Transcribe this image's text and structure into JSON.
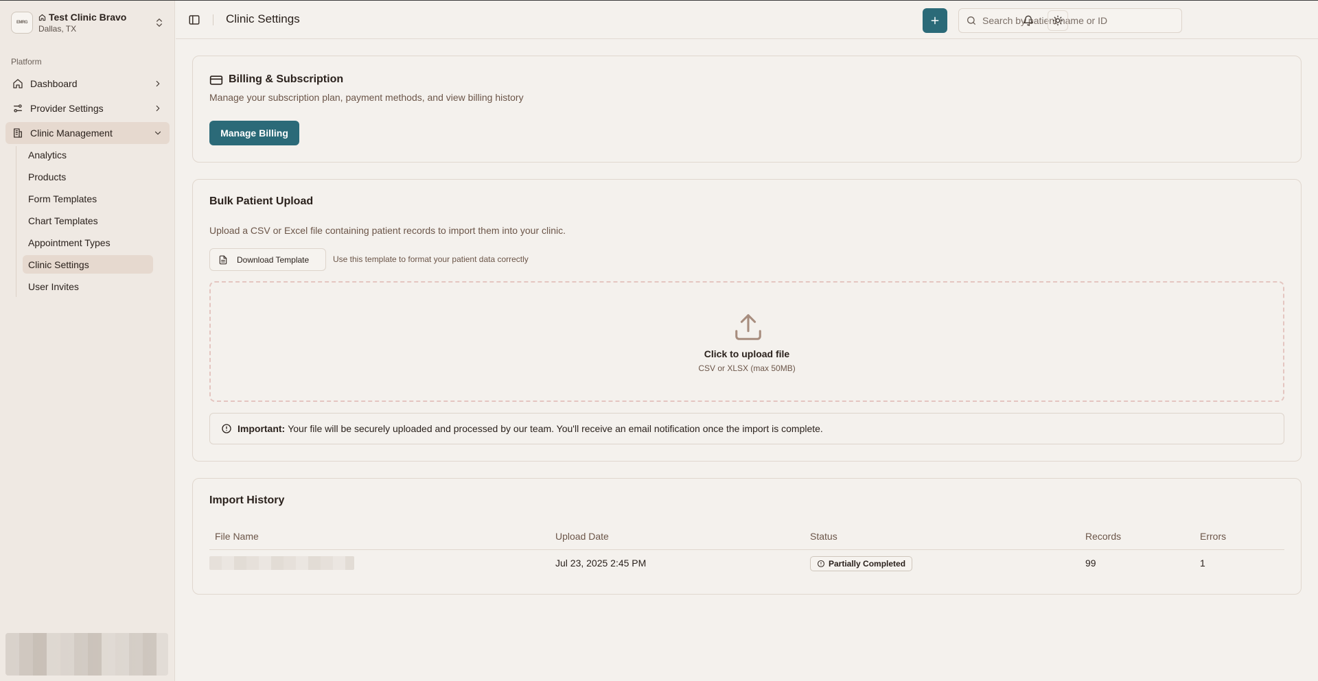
{
  "clinic": {
    "logo_text": "EMRG",
    "name": "Test Clinic Bravo",
    "city": "Dallas, TX"
  },
  "sidebar": {
    "section_label": "Platform",
    "items": [
      {
        "label": "Dashboard",
        "icon": "home-icon"
      },
      {
        "label": "Provider Settings",
        "icon": "sliders-icon"
      },
      {
        "label": "Clinic Management",
        "icon": "building-icon"
      }
    ],
    "subitems": [
      {
        "label": "Analytics"
      },
      {
        "label": "Products"
      },
      {
        "label": "Form Templates"
      },
      {
        "label": "Chart Templates"
      },
      {
        "label": "Appointment Types"
      },
      {
        "label": "Clinic Settings"
      },
      {
        "label": "User Invites"
      }
    ]
  },
  "header": {
    "title": "Clinic Settings",
    "search_placeholder": "Search by patient name or ID"
  },
  "billing": {
    "title": "Billing & Subscription",
    "description": "Manage your subscription plan, payment methods, and view billing history",
    "button_label": "Manage Billing"
  },
  "bulk": {
    "title": "Bulk Patient Upload",
    "description": "Upload a CSV or Excel file containing patient records to import them into your clinic.",
    "download_label": "Download Template",
    "download_hint": "Use this template to format your patient data correctly",
    "upload_title": "Click to upload file",
    "upload_sub": "CSV or XLSX (max 50MB)",
    "notice_strong": "Important:",
    "notice_text": "Your file will be securely uploaded and processed by our team. You'll receive an email notification once the import is complete."
  },
  "history": {
    "title": "Import History",
    "columns": [
      "File Name",
      "Upload Date",
      "Status",
      "Records",
      "Errors"
    ],
    "rows": [
      {
        "upload_date": "Jul 23, 2025 2:45 PM",
        "status": "Partially Completed",
        "records": "99",
        "errors": "1"
      }
    ]
  },
  "colors": {
    "accent": "#2b6a78",
    "background": "#f4f1ed",
    "sidebar": "#efe9e3",
    "active_item": "#e6d9cf"
  }
}
